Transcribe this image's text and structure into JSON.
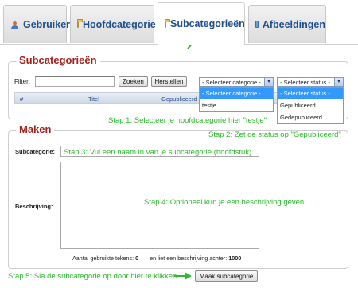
{
  "tabs": [
    {
      "label": "Gebruiker",
      "icon": "user-icon",
      "active": false
    },
    {
      "label": "Hoofdcategorie",
      "icon": "folder-icon",
      "active": false
    },
    {
      "label": "Subcategorieën",
      "icon": "folder-icon",
      "active": true
    },
    {
      "label": "Afbeeldingen",
      "icon": "image-icon",
      "active": false
    }
  ],
  "list_section": {
    "title": "Subcategorieën",
    "filter_label": "Filter:",
    "filter_value": "",
    "search_button": "Zoeken",
    "reset_button": "Herstellen",
    "category_select": {
      "selected": "- Selecteer categorie -",
      "options": [
        "- Selecteer categorie -",
        "testje"
      ]
    },
    "status_select": {
      "selected": "- Selecteer status -",
      "options": [
        "- Selecteer status -",
        "Gepubliceerd",
        "Gedepubliceerd"
      ]
    },
    "table_headers": [
      "#",
      "Titel",
      "Gepubliceerd"
    ]
  },
  "form_section": {
    "title": "Maken",
    "subcategory_label": "Subcategorie:",
    "subcategory_value": "",
    "description_label": "Beschrijving:",
    "description_value": "",
    "counter_used_label": "Aantal gebruikte tekens:",
    "counter_used_value": "0",
    "counter_remaining_label": "en liet een beschrijving achter:",
    "counter_remaining_value": "1000",
    "submit_button": "Maak subcategorie"
  },
  "annotations": {
    "step1": "Stap 1: Selecteer je hoofdcategorie hier \"testje\"",
    "step2": "Stap 2: Zet de status op \"Gepubliceerd\"",
    "step3": "Stap 3: Vul een naam in van je subcategorie (hoofdstuk)",
    "step4": "Stap 4: Optioneel kun je een beschrijving geven",
    "step5": "Stap 5: Sla de subcategorie op door hier te klikken",
    "color": "#2bbb2b"
  },
  "colors": {
    "legend_red": "#a0231f",
    "tab_text_blue": "#1f4e8c",
    "highlight_blue": "#3399ff"
  }
}
